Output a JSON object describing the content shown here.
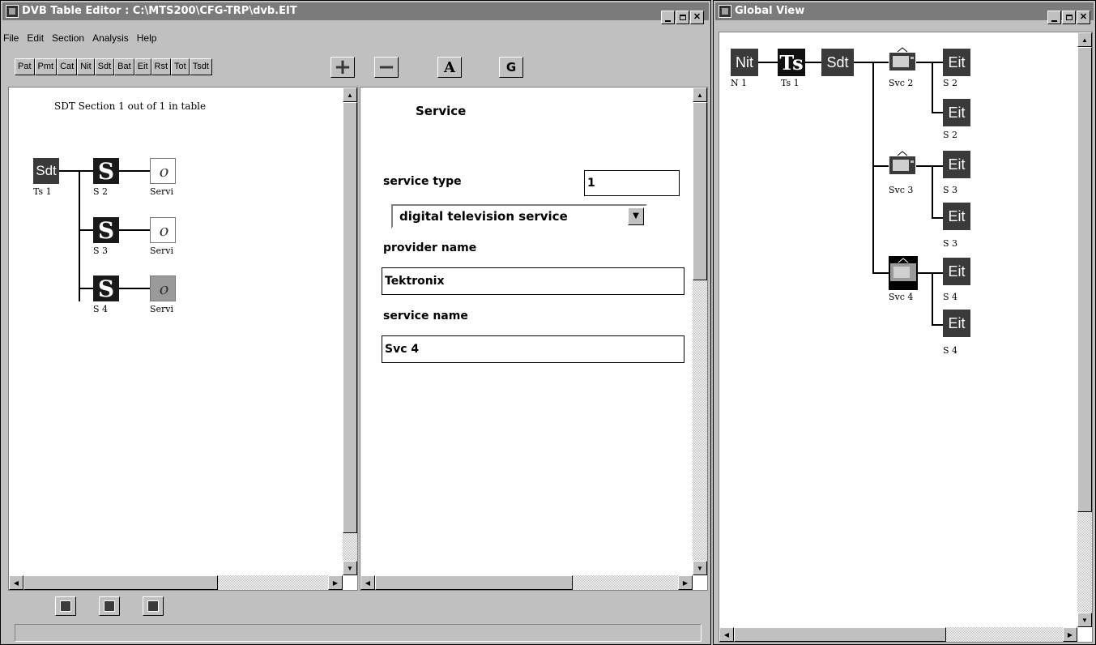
{
  "editor": {
    "title": "DVB Table Editor : C:\\MTS200\\CFG-TRP\\dvb.EIT",
    "menu": [
      "File",
      "Edit",
      "Section",
      "Analysis",
      "Help"
    ],
    "table_buttons": [
      "Pat",
      "Pmt",
      "Cat",
      "Nit",
      "Sdt",
      "Bat",
      "Eit",
      "Rst",
      "Tot",
      "Tsdt"
    ],
    "tool_buttons": {
      "add": "+",
      "remove": "−",
      "a": "A",
      "g": "G"
    },
    "tree": {
      "header": "SDT Section 1 out of 1 in table",
      "root": {
        "label": "Sdt",
        "caption": "Ts 1"
      },
      "rows": [
        {
          "node": "S",
          "caption": "S 2",
          "svc_caption": "Servi"
        },
        {
          "node": "S",
          "caption": "S 3",
          "svc_caption": "Servi"
        },
        {
          "node": "S",
          "caption": "S 4",
          "svc_caption": "Servi"
        }
      ]
    },
    "detail": {
      "title": "Service",
      "service_type_label": "service type",
      "service_type_value": "1",
      "service_type_select": "digital television service",
      "provider_name_label": "provider name",
      "provider_name_value": "Tektronix",
      "service_name_label": "service name",
      "service_name_value": "Svc 4"
    }
  },
  "global": {
    "title": "Global View",
    "nit": {
      "label": "Nit",
      "caption": "N 1"
    },
    "ts": {
      "label": "Ts",
      "caption": "Ts 1"
    },
    "sdt": {
      "label": "Sdt"
    },
    "services": [
      {
        "caption": "Svc 2",
        "eits": [
          {
            "label": "Eit",
            "caption": "S 2"
          },
          {
            "label": "Eit",
            "caption": "S 2"
          }
        ]
      },
      {
        "caption": "Svc 3",
        "eits": [
          {
            "label": "Eit",
            "caption": "S 3"
          },
          {
            "label": "Eit",
            "caption": "S 3"
          }
        ]
      },
      {
        "caption": "Svc 4",
        "eits": [
          {
            "label": "Eit",
            "caption": "S 4"
          },
          {
            "label": "Eit",
            "caption": "S 4"
          }
        ]
      }
    ]
  }
}
